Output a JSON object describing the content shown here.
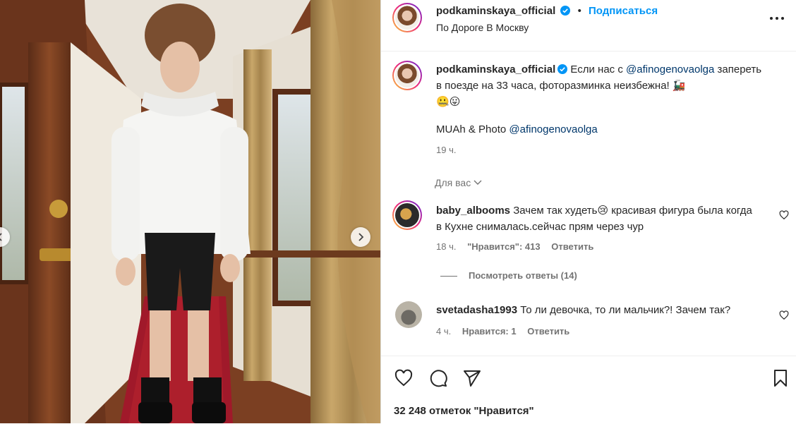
{
  "post": {
    "username": "podkaminskaya_official",
    "follow_label": "Подписаться",
    "location": "По Дороге В Москву",
    "caption_text_1": "Если нас с",
    "caption_mention": "@afinogenovaolga",
    "caption_text_2": "запереть в поезде на 33 часа, фоторазминка неизбежна!",
    "caption_emoji_1": "🚂",
    "caption_emoji_2": "🤐",
    "caption_emoji_3": "😛",
    "credit_text": "MUAh & Photo",
    "credit_mention": "@afinogenovaolga",
    "time": "19 ч.",
    "for_you": "Для вас"
  },
  "comments": [
    {
      "username": "baby_albooms",
      "text_1": "Зачем так худеть",
      "emoji": "😢",
      "text_2": " красивая фигура была когда в Кухне снималась.сейчас прям через чур",
      "time": "18 ч.",
      "likes": "\"Нравится\": 413",
      "reply": "Ответить",
      "view_replies": "Посмотреть ответы (14)"
    },
    {
      "username": "svetadasha1993",
      "text": "То ли девочка, то ли мальчик?! Зачем так?",
      "time": "4 ч.",
      "likes": "Нравится: 1",
      "reply": "Ответить"
    }
  ],
  "footer": {
    "likes_count": "32 248 отметок \"Нравится\""
  },
  "colors": {
    "accent": "#0095f6",
    "mention": "#00376b",
    "secondary_text": "#737373"
  }
}
